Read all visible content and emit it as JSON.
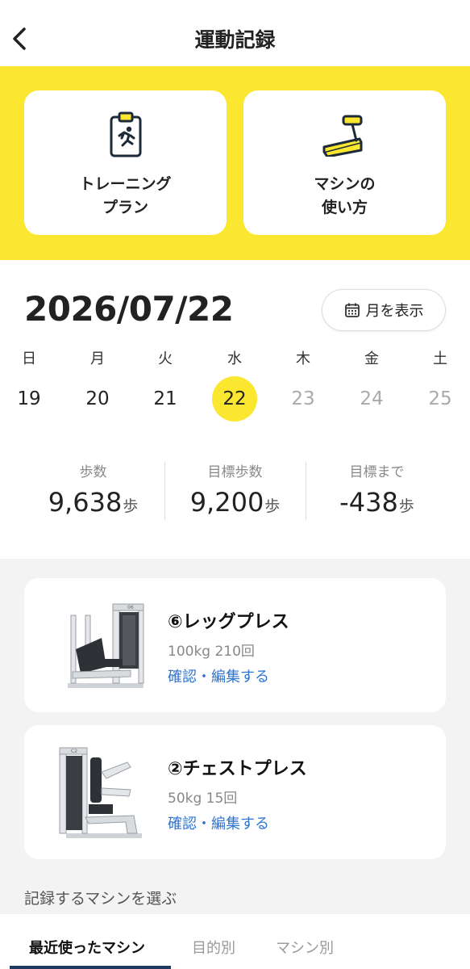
{
  "header": {
    "title": "運動記録",
    "back_icon": "chevron-left-icon"
  },
  "banner": {
    "color": "#fbe730",
    "cards": [
      {
        "label_line1": "トレーニング",
        "label_line2": "プラン",
        "icon": "clipboard-runner-icon"
      },
      {
        "label_line1": "マシンの",
        "label_line2": "使い方",
        "icon": "treadmill-icon"
      }
    ]
  },
  "date": {
    "title": "2026/07/22",
    "month_button": "月を表示",
    "month_icon": "calendar-icon"
  },
  "week": {
    "days": [
      {
        "dow": "日",
        "num": "19",
        "state": "past"
      },
      {
        "dow": "月",
        "num": "20",
        "state": "past"
      },
      {
        "dow": "火",
        "num": "21",
        "state": "past"
      },
      {
        "dow": "水",
        "num": "22",
        "state": "selected"
      },
      {
        "dow": "木",
        "num": "23",
        "state": "future"
      },
      {
        "dow": "金",
        "num": "24",
        "state": "future"
      },
      {
        "dow": "土",
        "num": "25",
        "state": "future"
      }
    ]
  },
  "stats": [
    {
      "label": "歩数",
      "value": "9,638",
      "unit": "歩"
    },
    {
      "label": "目標歩数",
      "value": "9,200",
      "unit": "歩"
    },
    {
      "label": "目標まで",
      "value": "-438",
      "unit": "歩"
    }
  ],
  "records": [
    {
      "name": "⑥レッグプレス",
      "detail": "100kg 210回",
      "link": "確認・編集する",
      "image": "leg-press-machine-image"
    },
    {
      "name": "②チェストプレス",
      "detail": "50kg 15回",
      "link": "確認・編集する",
      "image": "chest-press-machine-image"
    }
  ],
  "section_label": "記録するマシンを選ぶ",
  "tabs": [
    {
      "label": "最近使ったマシン",
      "active": true
    },
    {
      "label": "目的別",
      "active": false
    },
    {
      "label": "マシン別",
      "active": false
    }
  ],
  "colors": {
    "accent": "#fbe730",
    "link": "#2f74d0",
    "tab_underline": "#1f3a5f"
  }
}
